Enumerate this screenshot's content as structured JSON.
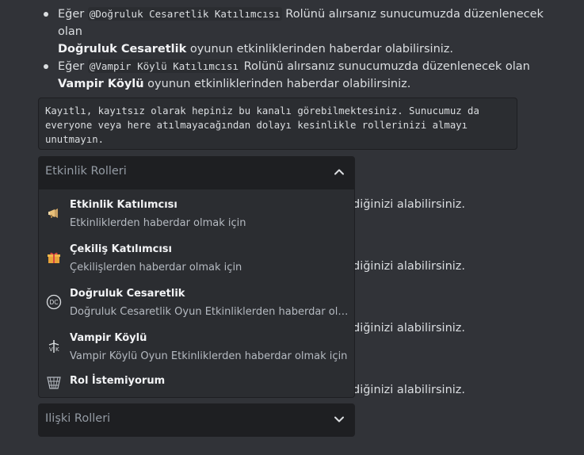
{
  "bullets": [
    {
      "prefix": "Eğer ",
      "mention": "@Doğruluk Cesaretlik Katılımcısı",
      "middle": " Rolünü alırsanız sunucumuzda düzenlenecek olan",
      "bold": "Doğruluk Cesaretlik",
      "suffix": " oyunun etkinliklerinden haberdar olabilirsiniz."
    },
    {
      "prefix": "Eğer ",
      "mention": "@Vampir Köylü Katılımcısı",
      "middle": " Rolünü alırsanız sunucumuzda düzenlenecek olan ",
      "bold": "Vampir Köylü",
      "suffix": " oyunun etkinliklerinden haberdar olabilirsiniz."
    }
  ],
  "codeblock": "Kayıtlı, kayıtsız olarak hepiniz bu kanalı görebilmektesiniz. Sunucumuz da\neveryone veya here atılmayacağından dolayı kesinlikle rollerinizi almayı\nunutmayın.",
  "behind_texts": [
    "diğinizi alabilirsiniz.",
    "diğinizi alabilirsiniz.",
    "diğinizi alabilirsiniz.",
    "diğinizi alabilirsiniz."
  ],
  "select_event": {
    "placeholder": "Etkinlik Rolleri",
    "options": [
      {
        "icon": "megaphone-icon",
        "title": "Etkinlik Katılımcısı",
        "desc": "Etkinliklerden haberdar olmak için"
      },
      {
        "icon": "gift-icon",
        "title": "Çekiliş Katılımcısı",
        "desc": "Çekilişlerden haberdar olmak için"
      },
      {
        "icon": "dc-badge-icon",
        "title": "Doğruluk Cesaretlik",
        "desc": "Doğruluk Cesaretlik Oyun Etkinliklerden haberdar olmak için"
      },
      {
        "icon": "vampire-icon",
        "title": "Vampir Köylü",
        "desc": "Vampir Köylü Oyun Etkinliklerden haberdar olmak için"
      },
      {
        "icon": "basket-icon",
        "title": "Rol İstemiyorum",
        "desc": ""
      }
    ]
  },
  "select_relation": {
    "placeholder": "Ilişki Rolleri"
  }
}
